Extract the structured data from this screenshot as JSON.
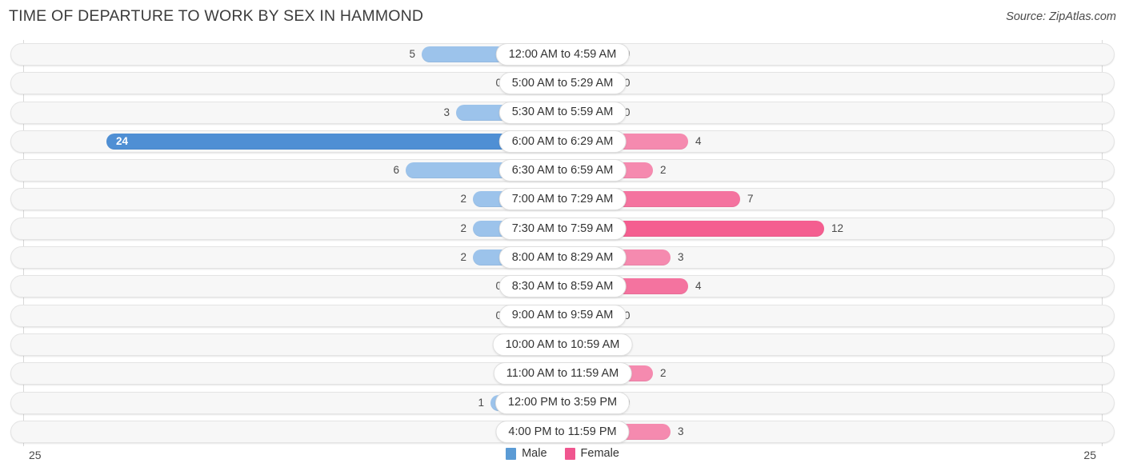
{
  "header": {
    "title": "TIME OF DEPARTURE TO WORK BY SEX IN HAMMOND",
    "source": "Source: ZipAtlas.com"
  },
  "legend": {
    "male_label": "Male",
    "female_label": "Female",
    "male_color": "#5b9bd5",
    "female_color": "#f0568f"
  },
  "axis": {
    "left_max": "25",
    "right_max": "25"
  },
  "chart_data": {
    "type": "bar",
    "title": "TIME OF DEPARTURE TO WORK BY SEX IN HAMMOND",
    "subtitle": "",
    "xlabel": "",
    "ylabel": "",
    "orientation": "horizontal-diverging",
    "grid": false,
    "legend_position": "bottom-center",
    "axis_max": 25,
    "xlim": [
      25,
      25
    ],
    "categories": [
      "12:00 AM to 4:59 AM",
      "5:00 AM to 5:29 AM",
      "5:30 AM to 5:59 AM",
      "6:00 AM to 6:29 AM",
      "6:30 AM to 6:59 AM",
      "7:00 AM to 7:29 AM",
      "7:30 AM to 7:59 AM",
      "8:00 AM to 8:29 AM",
      "8:30 AM to 8:59 AM",
      "9:00 AM to 9:59 AM",
      "10:00 AM to 10:59 AM",
      "11:00 AM to 11:59 AM",
      "12:00 PM to 3:59 PM",
      "4:00 PM to 11:59 PM"
    ],
    "series": [
      {
        "name": "Male",
        "color": "#9cc3eb",
        "values": [
          5,
          0,
          3,
          24,
          6,
          2,
          2,
          2,
          0,
          0,
          0,
          0,
          1,
          0
        ]
      },
      {
        "name": "Female",
        "color": "#f7afc8",
        "values": [
          0,
          0,
          0,
          4,
          2,
          7,
          12,
          3,
          4,
          0,
          0,
          2,
          0,
          3
        ]
      }
    ]
  },
  "rows": [
    {
      "category": "12:00 AM to 4:59 AM",
      "male": "5",
      "female": "0",
      "male_w": 176,
      "female_w": 68,
      "male_peak": false,
      "female_tone": ""
    },
    {
      "category": "5:00 AM to 5:29 AM",
      "male": "0",
      "female": "0",
      "male_w": 68,
      "female_w": 68,
      "male_peak": false,
      "female_tone": ""
    },
    {
      "category": "5:30 AM to 5:59 AM",
      "male": "3",
      "female": "0",
      "male_w": 133,
      "female_w": 68,
      "male_peak": false,
      "female_tone": ""
    },
    {
      "category": "6:00 AM to 6:29 AM",
      "male": "24",
      "female": "4",
      "male_w": 570,
      "female_w": 157,
      "male_peak": true,
      "female_tone": "mid"
    },
    {
      "category": "6:30 AM to 6:59 AM",
      "male": "6",
      "female": "2",
      "male_w": 196,
      "female_w": 113,
      "male_peak": false,
      "female_tone": "mid"
    },
    {
      "category": "7:00 AM to 7:29 AM",
      "male": "2",
      "female": "7",
      "male_w": 112,
      "female_w": 222,
      "male_peak": false,
      "female_tone": "high"
    },
    {
      "category": "7:30 AM to 7:59 AM",
      "male": "2",
      "female": "12",
      "male_w": 112,
      "female_w": 327,
      "male_peak": false,
      "female_tone": "peak"
    },
    {
      "category": "8:00 AM to 8:29 AM",
      "male": "2",
      "female": "3",
      "male_w": 112,
      "female_w": 135,
      "male_peak": false,
      "female_tone": "mid"
    },
    {
      "category": "8:30 AM to 8:59 AM",
      "male": "0",
      "female": "4",
      "male_w": 68,
      "female_w": 157,
      "male_peak": false,
      "female_tone": "high"
    },
    {
      "category": "9:00 AM to 9:59 AM",
      "male": "0",
      "female": "0",
      "male_w": 68,
      "female_w": 68,
      "male_peak": false,
      "female_tone": ""
    },
    {
      "category": "10:00 AM to 10:59 AM",
      "male": "0",
      "female": "0",
      "male_w": 68,
      "female_w": 68,
      "male_peak": false,
      "female_tone": ""
    },
    {
      "category": "11:00 AM to 11:59 AM",
      "male": "0",
      "female": "2",
      "male_w": 68,
      "female_w": 113,
      "male_peak": false,
      "female_tone": "mid"
    },
    {
      "category": "12:00 PM to 3:59 PM",
      "male": "1",
      "female": "0",
      "male_w": 90,
      "female_w": 68,
      "male_peak": false,
      "female_tone": ""
    },
    {
      "category": "4:00 PM to 11:59 PM",
      "male": "0",
      "female": "3",
      "male_w": 68,
      "female_w": 135,
      "male_peak": false,
      "female_tone": "mid"
    }
  ]
}
